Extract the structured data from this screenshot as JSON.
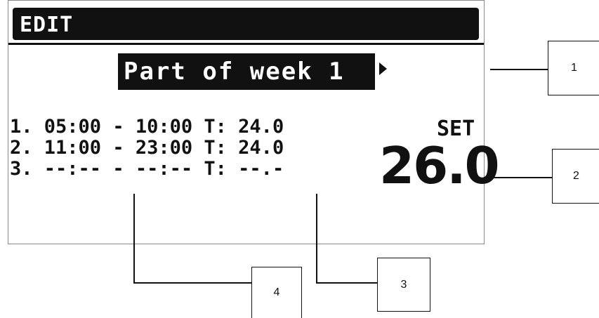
{
  "header": {
    "title": "EDIT"
  },
  "week": {
    "label": "Part of week 1"
  },
  "schedule": [
    {
      "num": "1.",
      "start": "05:00",
      "end": "10:00",
      "t_label": "T:",
      "temp": "24.0"
    },
    {
      "num": "2.",
      "start": "11:00",
      "end": "23:00",
      "t_label": "T:",
      "temp": "24.0"
    },
    {
      "num": "3.",
      "start": "--:--",
      "end": "--:--",
      "t_label": "T:",
      "temp": "--.-"
    }
  ],
  "set": {
    "label": "SET",
    "value": "26.0"
  },
  "callouts": [
    {
      "number": "1"
    },
    {
      "number": "2"
    },
    {
      "number": "3"
    },
    {
      "number": "4"
    }
  ]
}
